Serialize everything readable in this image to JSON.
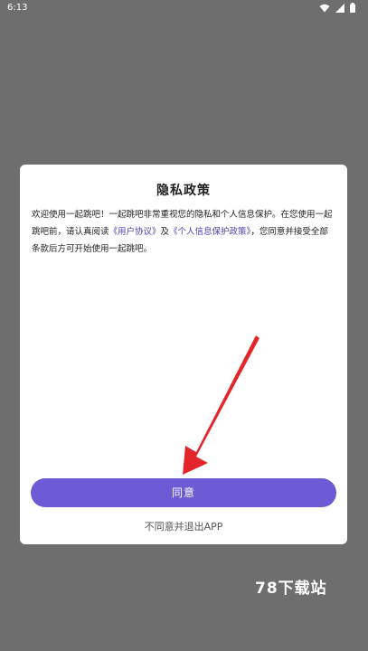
{
  "status_bar": {
    "time": "6:13"
  },
  "dialog": {
    "title": "隐私政策",
    "body_prefix": "欢迎使用一起跳吧！一起跳吧非常重视您的隐私和个人信息保护。在您使用一起跳吧前，请认真阅读",
    "user_agreement_link": "《用户协议》",
    "and_text": "及",
    "privacy_policy_link": "《个人信息保护政策》",
    "body_suffix": "，您同意并接受全部条款后方可开始使用一起跳吧。",
    "agree_label": "同意",
    "disagree_label": "不同意并退出APP"
  },
  "watermark": "78下载站",
  "colors": {
    "accent": "#6c5bd5",
    "link": "#4b3fb6",
    "arrow": "#e2262b",
    "backdrop": "#6e6e6e"
  },
  "icons": {
    "wifi": "wifi-icon",
    "signal": "signal-icon",
    "battery": "battery-icon"
  }
}
